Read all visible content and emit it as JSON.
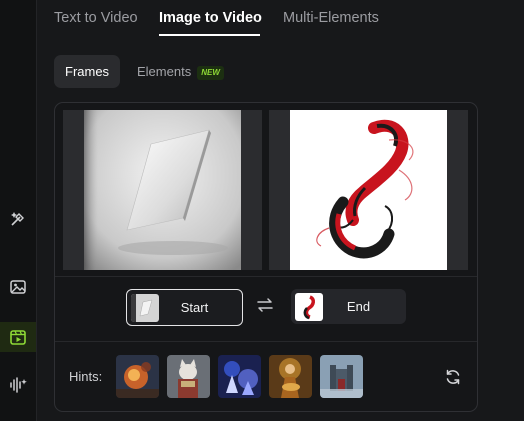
{
  "tabs": [
    {
      "label": "Text to Video",
      "active": false
    },
    {
      "label": "Image to Video",
      "active": true
    },
    {
      "label": "Multi-Elements",
      "active": false
    }
  ],
  "subtabs": {
    "frames": "Frames",
    "elements": "Elements",
    "new_badge": "NEW"
  },
  "frames": {
    "start_label": "Start",
    "end_label": "End",
    "start_image": "tilted-white-panel",
    "end_image": "red-black-koi-fish"
  },
  "hints": {
    "label": "Hints:",
    "thumbnails": [
      "fiery-explosion",
      "armored-cat-warrior",
      "blue-crystal-figures",
      "golden-musician",
      "misty-castle"
    ]
  },
  "sidebar": {
    "icons": [
      "magic-wand-icon",
      "image-icon",
      "video-icon",
      "audio-wave-icon"
    ],
    "active": "video-icon"
  },
  "colors": {
    "accent": "#8ed936",
    "background": "#17181a",
    "panel_border": "#2f3034"
  }
}
